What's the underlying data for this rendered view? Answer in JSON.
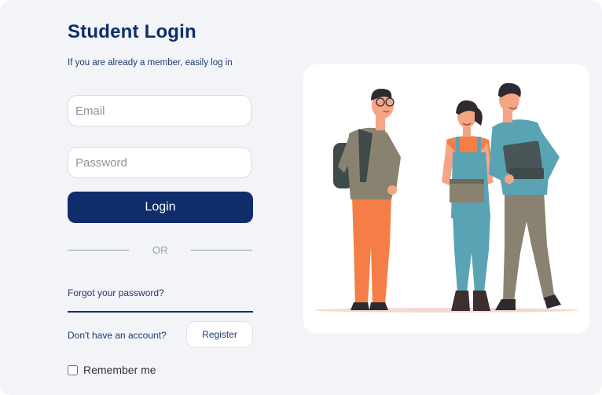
{
  "title": "Student Login",
  "subtitle": "If you are already a member, easily log in",
  "email": {
    "placeholder": "Email"
  },
  "password": {
    "placeholder": "Password"
  },
  "login_label": "Login",
  "or_text": "OR",
  "forgot_label": "Forgot your password?",
  "no_account_text": "Don't have an account?",
  "register_label": "Register",
  "remember_label": "Remember me",
  "colors": {
    "brand_navy": "#0f2d6b",
    "card_background": "#f2f4f7",
    "accent_orange": "#f47e45",
    "accent_teal": "#5aa3b5",
    "khaki": "#8a8270"
  },
  "illustration": {
    "icon": "students-group-illustration"
  }
}
